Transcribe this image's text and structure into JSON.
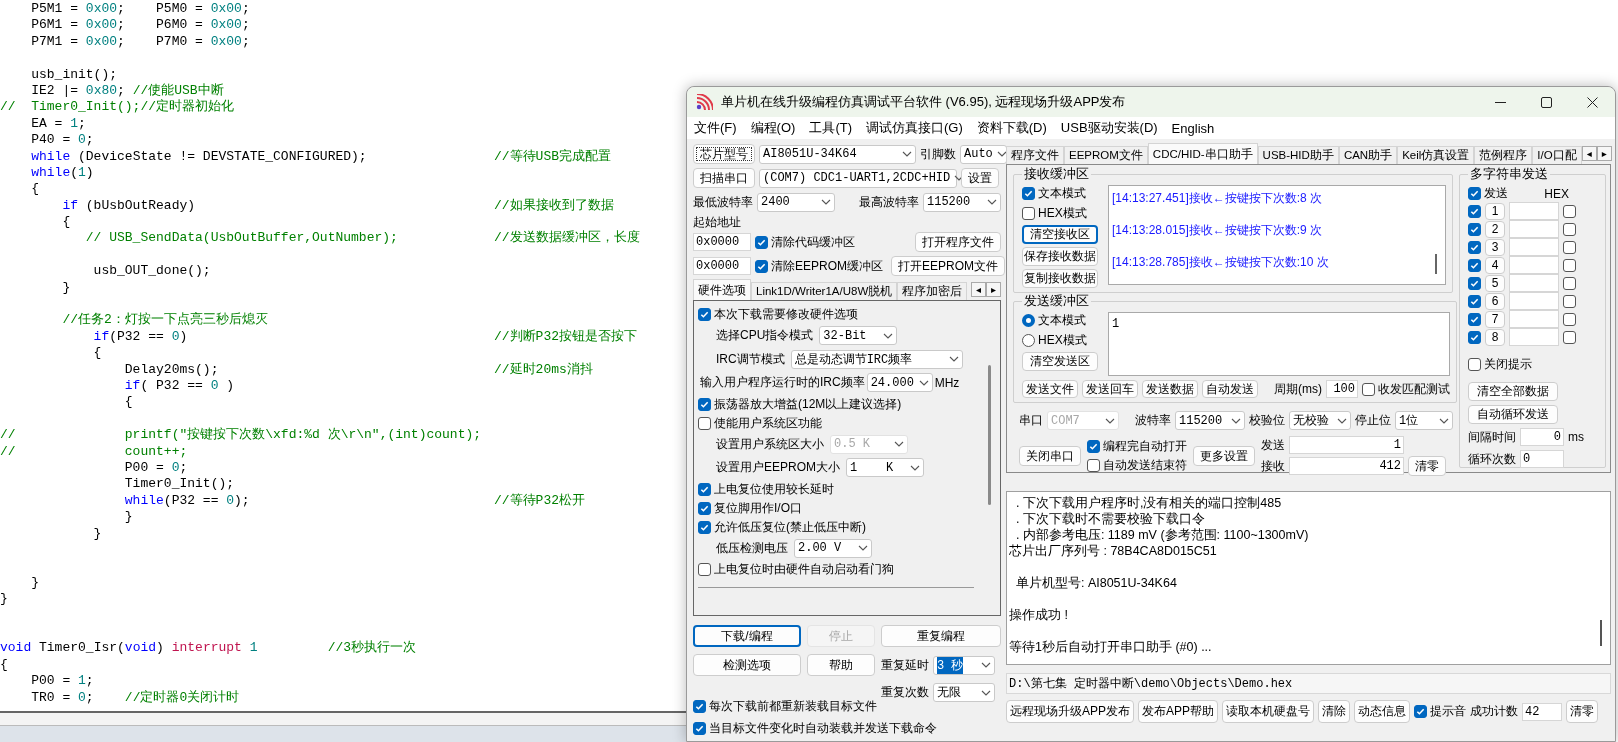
{
  "editor": {
    "lines": [
      {
        "tokens": [
          {
            "text": "    P5M1 = ",
            "kind": "plain"
          },
          {
            "text": "0x00",
            "kind": "number"
          },
          {
            "text": ";    P5M0 = ",
            "kind": "plain"
          },
          {
            "text": "0x00",
            "kind": "number"
          },
          {
            "text": ";",
            "kind": "plain"
          }
        ]
      },
      {
        "tokens": [
          {
            "text": "    P6M1 = ",
            "kind": "plain"
          },
          {
            "text": "0x00",
            "kind": "number"
          },
          {
            "text": ";    P6M0 = ",
            "kind": "plain"
          },
          {
            "text": "0x00",
            "kind": "number"
          },
          {
            "text": ";",
            "kind": "plain"
          }
        ]
      },
      {
        "tokens": [
          {
            "text": "    P7M1 = ",
            "kind": "plain"
          },
          {
            "text": "0x00",
            "kind": "number"
          },
          {
            "text": ";    P7M0 = ",
            "kind": "plain"
          },
          {
            "text": "0x00",
            "kind": "number"
          },
          {
            "text": ";",
            "kind": "plain"
          }
        ],
        "blank_after": true
      },
      {
        "tokens": [
          {
            "text": "    usb_init();",
            "kind": "plain"
          }
        ]
      },
      {
        "tokens": [
          {
            "text": "    IE2 |= ",
            "kind": "plain"
          },
          {
            "text": "0x80",
            "kind": "number"
          },
          {
            "text": "; ",
            "kind": "plain"
          },
          {
            "text": "//使能USB中断",
            "kind": "comment"
          }
        ]
      },
      {
        "tokens": [
          {
            "text": "//  Timer0_Init();//定时器初始化",
            "kind": "comment"
          }
        ]
      },
      {
        "tokens": [
          {
            "text": "    EA = ",
            "kind": "plain"
          },
          {
            "text": "1",
            "kind": "number"
          },
          {
            "text": ";",
            "kind": "plain"
          }
        ]
      },
      {
        "tokens": [
          {
            "text": "    P40 = ",
            "kind": "plain"
          },
          {
            "text": "0",
            "kind": "number"
          },
          {
            "text": ";",
            "kind": "plain"
          }
        ]
      },
      {
        "tokens": [
          {
            "text": "    while",
            "kind": "keyword"
          },
          {
            "text": " (DeviceState != DEVSTATE_CONFIGURED);",
            "kind": "plain"
          }
        ],
        "comment": "//等待USB完成配置"
      },
      {
        "tokens": [
          {
            "text": "    while",
            "kind": "keyword"
          },
          {
            "text": "(",
            "kind": "plain"
          },
          {
            "text": "1",
            "kind": "number"
          },
          {
            "text": ")",
            "kind": "plain"
          }
        ]
      },
      {
        "tokens": [
          {
            "text": "    {",
            "kind": "plain"
          }
        ]
      },
      {
        "tokens": [
          {
            "text": "        if",
            "kind": "keyword"
          },
          {
            "text": " (bUsbOutReady)",
            "kind": "plain"
          }
        ],
        "comment": "//如果接收到了数据"
      },
      {
        "tokens": [
          {
            "text": "        {",
            "kind": "plain"
          }
        ]
      },
      {
        "tokens": [
          {
            "text": "           // USB_SendData(UsbOutBuffer,OutNumber);",
            "kind": "comment"
          }
        ],
        "comment": "//发送数据缓冲区，长度",
        "blank_after": true
      },
      {
        "tokens": [
          {
            "text": "            usb_OUT_done();",
            "kind": "plain"
          }
        ]
      },
      {
        "tokens": [
          {
            "text": "        }",
            "kind": "plain"
          }
        ],
        "blank_after": true
      },
      {
        "tokens": [
          {
            "text": "        //任务2：灯按一下点亮三秒后熄灭",
            "kind": "comment"
          }
        ]
      },
      {
        "tokens": [
          {
            "text": "            if",
            "kind": "keyword"
          },
          {
            "text": "(P32 == ",
            "kind": "plain"
          },
          {
            "text": "0",
            "kind": "number"
          },
          {
            "text": ")",
            "kind": "plain"
          }
        ],
        "comment": "//判断P32按钮是否按下"
      },
      {
        "tokens": [
          {
            "text": "            {",
            "kind": "plain"
          }
        ]
      },
      {
        "tokens": [
          {
            "text": "                Delay20ms();",
            "kind": "plain"
          }
        ],
        "comment": "//延时20ms消抖"
      },
      {
        "tokens": [
          {
            "text": "                if",
            "kind": "keyword"
          },
          {
            "text": "( P32 == ",
            "kind": "plain"
          },
          {
            "text": "0",
            "kind": "number"
          },
          {
            "text": " )",
            "kind": "plain"
          }
        ]
      },
      {
        "tokens": [
          {
            "text": "                {",
            "kind": "plain"
          }
        ],
        "blank_after": true
      },
      {
        "tokens": [
          {
            "text": "//              printf(\"按键按下次数\\xfd:%d 次\\r\\n\",(int)count);",
            "kind": "comment"
          }
        ]
      },
      {
        "tokens": [
          {
            "text": "//              count++;",
            "kind": "comment"
          }
        ]
      },
      {
        "tokens": [
          {
            "text": "                P00 = ",
            "kind": "plain"
          },
          {
            "text": "0",
            "kind": "number"
          },
          {
            "text": ";",
            "kind": "plain"
          }
        ]
      },
      {
        "tokens": [
          {
            "text": "                Timer0_Init();",
            "kind": "plain"
          }
        ]
      },
      {
        "tokens": [
          {
            "text": "                while",
            "kind": "keyword"
          },
          {
            "text": "(P32 == ",
            "kind": "plain"
          },
          {
            "text": "0",
            "kind": "number"
          },
          {
            "text": ");",
            "kind": "plain"
          }
        ],
        "comment": "//等待P32松开"
      },
      {
        "tokens": [
          {
            "text": "                }",
            "kind": "plain"
          }
        ]
      },
      {
        "tokens": [
          {
            "text": "            }",
            "kind": "plain"
          }
        ],
        "blank_after": true,
        "second_blank_after": true
      },
      {
        "tokens": [
          {
            "text": "    }",
            "kind": "plain"
          }
        ]
      },
      {
        "tokens": [
          {
            "text": "}",
            "kind": "plain"
          }
        ],
        "blank_after": true,
        "second_blank_after": true
      },
      {
        "tokens": [
          {
            "text": "void",
            "kind": "keyword"
          },
          {
            "text": " Timer0_Isr(",
            "kind": "plain"
          },
          {
            "text": "void",
            "kind": "keyword"
          },
          {
            "text": ") ",
            "kind": "plain"
          },
          {
            "text": "interrupt ",
            "kind": "attribute"
          },
          {
            "text": "1",
            "kind": "number"
          },
          {
            "text": "         //3秒执行一次",
            "kind": "comment"
          }
        ]
      },
      {
        "tokens": [
          {
            "text": "{",
            "kind": "plain"
          }
        ]
      },
      {
        "tokens": [
          {
            "text": "    P00 = ",
            "kind": "plain"
          },
          {
            "text": "1",
            "kind": "number"
          },
          {
            "text": ";",
            "kind": "plain"
          }
        ]
      },
      {
        "tokens": [
          {
            "text": "    TR0 = ",
            "kind": "plain"
          },
          {
            "text": "0",
            "kind": "number"
          },
          {
            "text": ";    ",
            "kind": "plain"
          },
          {
            "text": "//定时器0关闭计时",
            "kind": "comment"
          }
        ]
      }
    ]
  },
  "window": {
    "title": "单片机在线升级编程仿真调试平台软件 (V6.95), 远程现场升级APP发布",
    "menu": [
      "文件(F)",
      "编程(O)",
      "工具(T)",
      "调试仿真接口(G)",
      "资料下载(D)",
      "USB驱动安装(D)",
      "English"
    ]
  },
  "programmer": {
    "chip_button": "芯片型号",
    "chip": "AI8051U-34K64",
    "pins_label": "引脚数",
    "pins": "Auto",
    "scan_button": "扫描串口",
    "port": "(COM7) CDC1-UART1,2CDC+HID",
    "settings_button": "设置",
    "min_baud_label": "最低波特率",
    "min_baud": "2400",
    "max_baud_label": "最高波特率",
    "max_baud": "115200",
    "start_address_label": "起始地址",
    "buffers": [
      {
        "address": "0x0000",
        "label": "清除代码缓冲区",
        "checked": true,
        "button": "打开程序文件"
      },
      {
        "address": "0x0000",
        "label": "清除EEPROM缓冲区",
        "checked": true,
        "button": "打开EEPROM文件"
      }
    ],
    "tabs": [
      {
        "label": "硬件选项",
        "selected": true
      },
      {
        "label": "Link1D/Writer1A/U8W脱机",
        "selected": false
      },
      {
        "label": "程序加密后",
        "selected": false
      }
    ],
    "tab_scroll": [
      "◂",
      "▸"
    ],
    "options": [
      {
        "kind": "check",
        "label": "本次下载需要修改硬件选项",
        "checked": true
      },
      {
        "kind": "select",
        "label": "选择CPU指令模式",
        "value": "32-Bit",
        "disabled": false
      },
      {
        "kind": "select",
        "label": "IRC调节模式",
        "value": "总是动态调节IRC频率",
        "disabled": false
      },
      {
        "kind": "frequency",
        "label": "输入用户程序运行时的IRC频率",
        "value": "24.000",
        "unit": "MHz"
      },
      {
        "kind": "check",
        "label": "振荡器放大增益(12M以上建议选择)",
        "checked": true
      },
      {
        "kind": "check",
        "label": "使能用户系统区功能",
        "checked": false
      },
      {
        "kind": "select",
        "label": "设置用户系统区大小",
        "value": "0.5 K",
        "disabled": true
      },
      {
        "kind": "select",
        "label": "设置用户EEPROM大小",
        "value": "1    K",
        "disabled": false
      },
      {
        "kind": "check",
        "label": "上电复位使用较长延时",
        "checked": true
      },
      {
        "kind": "check",
        "label": "复位脚用作I/O口",
        "checked": true
      },
      {
        "kind": "check",
        "label": "允许低压复位(禁止低压中断)",
        "checked": true
      },
      {
        "kind": "select",
        "label": "低压检测电压",
        "value": "2.00 V",
        "disabled": false
      },
      {
        "kind": "check",
        "label": "上电复位时由硬件自动启动看门狗",
        "checked": false
      }
    ],
    "actions": [
      {
        "label": "下载/编程",
        "focused": true,
        "disabled": false
      },
      {
        "label": "停止",
        "focused": false,
        "disabled": true
      },
      {
        "label": "重复编程",
        "focused": false,
        "disabled": false
      },
      {
        "label": "检测选项",
        "focused": false,
        "disabled": false
      },
      {
        "label": "帮助",
        "focused": false,
        "disabled": false
      }
    ],
    "repeat_delay_label": "重复延时",
    "repeat_delay": "3 秒",
    "repeat_count_label": "重复次数",
    "repeat_count": "无限",
    "auto_options": [
      {
        "label": "每次下载前都重新装载目标文件",
        "checked": true
      },
      {
        "label": "当目标文件变化时自动装载并发送下载命令",
        "checked": true
      }
    ]
  },
  "serial_assistant": {
    "tabs": [
      {
        "label": "程序文件",
        "selected": false
      },
      {
        "label": "EEPROM文件",
        "selected": false
      },
      {
        "label": "CDC/HID-串口助手",
        "selected": true
      },
      {
        "label": "USB-HID助手",
        "selected": false
      },
      {
        "label": "CAN助手",
        "selected": false
      },
      {
        "label": "Keil仿真设置",
        "selected": false
      },
      {
        "label": "范例程序",
        "selected": false
      },
      {
        "label": "I/O口配",
        "selected": false
      }
    ],
    "tab_scroll": [
      "◂",
      "▸"
    ],
    "receive": {
      "title": "接收缓冲区",
      "modes": [
        {
          "label": "文本模式",
          "checked": true
        },
        {
          "label": "HEX模式",
          "checked": false
        }
      ],
      "buttons": [
        {
          "label": "清空接收区",
          "focused": true
        },
        {
          "label": "保存接收数据",
          "focused": false
        },
        {
          "label": "复制接收数据",
          "focused": false
        }
      ],
      "log": [
        "[14:13:27.451]接收←按键按下次数:8 次",
        "[14:13:28.015]接收←按键按下次数:9 次",
        "[14:13:28.785]接收←按键按下次数:10 次"
      ]
    },
    "send": {
      "title": "发送缓冲区",
      "modes": [
        {
          "label": "文本模式",
          "selected": true
        },
        {
          "label": "HEX模式",
          "selected": false
        }
      ],
      "clear_button": "清空发送区",
      "text": "1",
      "buttons": [
        "发送文件",
        "发送回车",
        "发送数据",
        "自动发送"
      ],
      "period_label": "周期(ms)",
      "period": "100",
      "match_test": {
        "label": "收发匹配测试",
        "checked": false
      }
    },
    "port": {
      "port_label": "串口",
      "port": "COM7",
      "port_disabled": true,
      "baud_label": "波特率",
      "baud": "115200",
      "parity_label": "校验位",
      "parity": "无校验",
      "stop_label": "停止位",
      "stop": "1位",
      "close_button": "关闭串口",
      "options": [
        {
          "label": "编程完自动打开",
          "checked": true
        },
        {
          "label": "自动发送结束符",
          "checked": false
        }
      ],
      "more_button": "更多设置",
      "sent_label": "发送",
      "sent": "1",
      "received_label": "接收",
      "received": "412",
      "reset_button": "清零"
    },
    "multi_send": {
      "title": "多字符串发送",
      "send_all": {
        "label": "发送",
        "checked": true
      },
      "hex_label": "HEX",
      "rows": [
        {
          "number": "1",
          "checked": true,
          "hex": false
        },
        {
          "number": "2",
          "checked": true,
          "hex": false
        },
        {
          "number": "3",
          "checked": true,
          "hex": false
        },
        {
          "number": "4",
          "checked": true,
          "hex": false
        },
        {
          "number": "5",
          "checked": true,
          "hex": false
        },
        {
          "number": "6",
          "checked": true,
          "hex": false
        },
        {
          "number": "7",
          "checked": true,
          "hex": false
        },
        {
          "number": "8",
          "checked": true,
          "hex": false
        }
      ],
      "close_hint": {
        "label": "关闭提示",
        "checked": false
      },
      "buttons": [
        "清空全部数据",
        "自动循环发送"
      ],
      "interval_label": "间隔时间",
      "interval": "0",
      "interval_unit": "ms",
      "loops_label": "循环次数",
      "loops": "0"
    }
  },
  "output": {
    "lines": [
      {
        "text": "  . 下次下载用户程序时,没有相关的端口控制485",
        "gap_before": false
      },
      {
        "text": "  . 下次下载时不需要校验下载口令",
        "gap_before": false
      },
      {
        "text": "  . 内部参考电压: 1189 mV (参考范围: 1100~1300mV)",
        "gap_before": false
      },
      {
        "text": "芯片出厂序列号 : 78B4CA8D015C51",
        "gap_before": false
      },
      {
        "text": "  单片机型号: AI8051U-34K64",
        "gap_before": true
      },
      {
        "text": "操作成功 !",
        "gap_before": true
      },
      {
        "text": "等待1秒后自动打开串口助手 (#0) ...",
        "gap_before": true
      }
    ]
  },
  "file_path": "D:\\第七集 定时器中断\\demo\\Objects\\Demo.hex",
  "footer": {
    "buttons": [
      "远程现场升级APP发布",
      "发布APP帮助",
      "读取本机硬盘号",
      "清除",
      "动态信息"
    ],
    "sound": {
      "label": "提示音",
      "checked": true
    },
    "count_label": "成功计数",
    "count": "42",
    "reset_button": "清零"
  }
}
